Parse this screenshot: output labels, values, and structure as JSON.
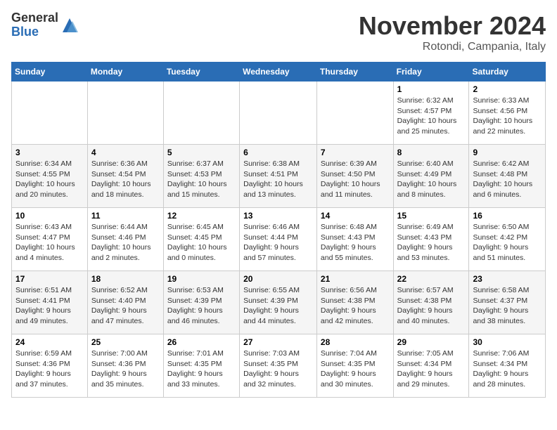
{
  "logo": {
    "general": "General",
    "blue": "Blue"
  },
  "title": "November 2024",
  "location": "Rotondi, Campania, Italy",
  "weekdays": [
    "Sunday",
    "Monday",
    "Tuesday",
    "Wednesday",
    "Thursday",
    "Friday",
    "Saturday"
  ],
  "weeks": [
    [
      {
        "day": "",
        "info": ""
      },
      {
        "day": "",
        "info": ""
      },
      {
        "day": "",
        "info": ""
      },
      {
        "day": "",
        "info": ""
      },
      {
        "day": "",
        "info": ""
      },
      {
        "day": "1",
        "info": "Sunrise: 6:32 AM\nSunset: 4:57 PM\nDaylight: 10 hours and 25 minutes."
      },
      {
        "day": "2",
        "info": "Sunrise: 6:33 AM\nSunset: 4:56 PM\nDaylight: 10 hours and 22 minutes."
      }
    ],
    [
      {
        "day": "3",
        "info": "Sunrise: 6:34 AM\nSunset: 4:55 PM\nDaylight: 10 hours and 20 minutes."
      },
      {
        "day": "4",
        "info": "Sunrise: 6:36 AM\nSunset: 4:54 PM\nDaylight: 10 hours and 18 minutes."
      },
      {
        "day": "5",
        "info": "Sunrise: 6:37 AM\nSunset: 4:53 PM\nDaylight: 10 hours and 15 minutes."
      },
      {
        "day": "6",
        "info": "Sunrise: 6:38 AM\nSunset: 4:51 PM\nDaylight: 10 hours and 13 minutes."
      },
      {
        "day": "7",
        "info": "Sunrise: 6:39 AM\nSunset: 4:50 PM\nDaylight: 10 hours and 11 minutes."
      },
      {
        "day": "8",
        "info": "Sunrise: 6:40 AM\nSunset: 4:49 PM\nDaylight: 10 hours and 8 minutes."
      },
      {
        "day": "9",
        "info": "Sunrise: 6:42 AM\nSunset: 4:48 PM\nDaylight: 10 hours and 6 minutes."
      }
    ],
    [
      {
        "day": "10",
        "info": "Sunrise: 6:43 AM\nSunset: 4:47 PM\nDaylight: 10 hours and 4 minutes."
      },
      {
        "day": "11",
        "info": "Sunrise: 6:44 AM\nSunset: 4:46 PM\nDaylight: 10 hours and 2 minutes."
      },
      {
        "day": "12",
        "info": "Sunrise: 6:45 AM\nSunset: 4:45 PM\nDaylight: 10 hours and 0 minutes."
      },
      {
        "day": "13",
        "info": "Sunrise: 6:46 AM\nSunset: 4:44 PM\nDaylight: 9 hours and 57 minutes."
      },
      {
        "day": "14",
        "info": "Sunrise: 6:48 AM\nSunset: 4:43 PM\nDaylight: 9 hours and 55 minutes."
      },
      {
        "day": "15",
        "info": "Sunrise: 6:49 AM\nSunset: 4:43 PM\nDaylight: 9 hours and 53 minutes."
      },
      {
        "day": "16",
        "info": "Sunrise: 6:50 AM\nSunset: 4:42 PM\nDaylight: 9 hours and 51 minutes."
      }
    ],
    [
      {
        "day": "17",
        "info": "Sunrise: 6:51 AM\nSunset: 4:41 PM\nDaylight: 9 hours and 49 minutes."
      },
      {
        "day": "18",
        "info": "Sunrise: 6:52 AM\nSunset: 4:40 PM\nDaylight: 9 hours and 47 minutes."
      },
      {
        "day": "19",
        "info": "Sunrise: 6:53 AM\nSunset: 4:39 PM\nDaylight: 9 hours and 46 minutes."
      },
      {
        "day": "20",
        "info": "Sunrise: 6:55 AM\nSunset: 4:39 PM\nDaylight: 9 hours and 44 minutes."
      },
      {
        "day": "21",
        "info": "Sunrise: 6:56 AM\nSunset: 4:38 PM\nDaylight: 9 hours and 42 minutes."
      },
      {
        "day": "22",
        "info": "Sunrise: 6:57 AM\nSunset: 4:38 PM\nDaylight: 9 hours and 40 minutes."
      },
      {
        "day": "23",
        "info": "Sunrise: 6:58 AM\nSunset: 4:37 PM\nDaylight: 9 hours and 38 minutes."
      }
    ],
    [
      {
        "day": "24",
        "info": "Sunrise: 6:59 AM\nSunset: 4:36 PM\nDaylight: 9 hours and 37 minutes."
      },
      {
        "day": "25",
        "info": "Sunrise: 7:00 AM\nSunset: 4:36 PM\nDaylight: 9 hours and 35 minutes."
      },
      {
        "day": "26",
        "info": "Sunrise: 7:01 AM\nSunset: 4:35 PM\nDaylight: 9 hours and 33 minutes."
      },
      {
        "day": "27",
        "info": "Sunrise: 7:03 AM\nSunset: 4:35 PM\nDaylight: 9 hours and 32 minutes."
      },
      {
        "day": "28",
        "info": "Sunrise: 7:04 AM\nSunset: 4:35 PM\nDaylight: 9 hours and 30 minutes."
      },
      {
        "day": "29",
        "info": "Sunrise: 7:05 AM\nSunset: 4:34 PM\nDaylight: 9 hours and 29 minutes."
      },
      {
        "day": "30",
        "info": "Sunrise: 7:06 AM\nSunset: 4:34 PM\nDaylight: 9 hours and 28 minutes."
      }
    ]
  ]
}
